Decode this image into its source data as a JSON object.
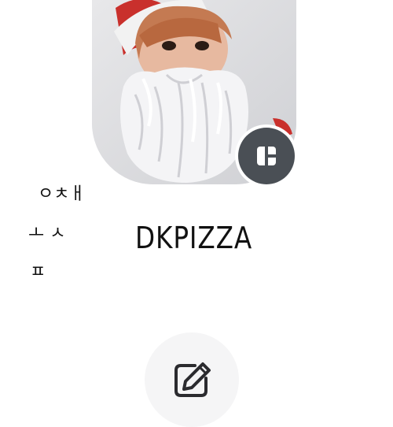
{
  "profile": {
    "name": "DKPIZZA"
  },
  "handwriting": {
    "lines": [
      "ㅇㅊㅐ",
      "ㅗ ㅅ",
      "ㅍ"
    ]
  },
  "icons": {
    "edit_photo": "dashboard-layout-icon",
    "write": "edit-note-icon"
  },
  "colors": {
    "background": "#ffffff",
    "badge": "#4a4f55",
    "write_button_bg": "#f5f5f6",
    "text": "#111111"
  }
}
